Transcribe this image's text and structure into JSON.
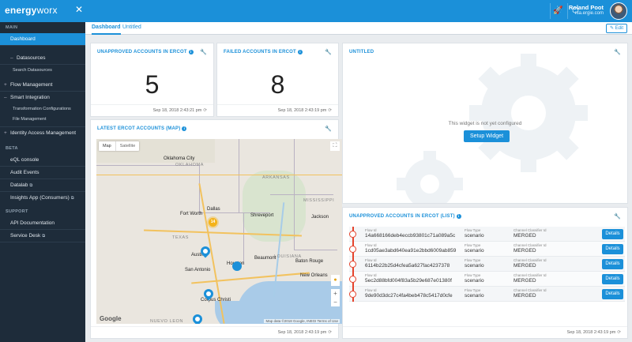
{
  "app": {
    "logo_bold": "energy",
    "logo_thin": "worx"
  },
  "user": {
    "name": "Roland Poot",
    "email": "rsa.ergie.com"
  },
  "sidebar": {
    "sections": {
      "main": "MAIN",
      "beta": "BETA",
      "support": "SUPPORT"
    },
    "items": {
      "dashboard": "Dashboard",
      "datasources": "Datasources",
      "search_datasources": "Search Datasources",
      "flow_management": "Flow Management",
      "smart_integration": "Smart Integration",
      "transformation_configurations": "Transformation Configurations",
      "file_management": "File Management",
      "identity_access": "Identity Access Management",
      "eql_console": "eQL console",
      "audit_events": "Audit Events",
      "datalab": "Datalab",
      "insights_app": "Insights App (Consumers)",
      "api_docs": "API Documentation",
      "service_desk": "Service Desk"
    }
  },
  "tabs": {
    "dashboard": "Dashboard",
    "untitled": "Untitled",
    "edit": "Edit"
  },
  "widgets": {
    "unapproved": {
      "title": "UNAPPROVED ACCOUNTS IN ERCOT",
      "value": "5",
      "timestamp": "Sep 18, 2018 2:43:21 pm"
    },
    "failed": {
      "title": "FAILED ACCOUNTS IN ERCOT",
      "value": "8",
      "timestamp": "Sep 18, 2018 2:43:19 pm"
    },
    "untitled": {
      "title": "UNTITLED",
      "message": "This widget is not yet configured",
      "button": "Setup Widget"
    },
    "map": {
      "title": "LATEST ERCOT ACCOUNTS (MAP)",
      "timestamp": "Sep 18, 2018 2:43:19 pm",
      "btn_map": "Map",
      "btn_satellite": "Satellite",
      "cluster_count": "14",
      "google": "Google",
      "attribution": "Map data ©2018 Google, INEGI   Terms of Use",
      "cities": {
        "oklahoma": "Oklahoma City",
        "oklahoma_state": "OKLAHOMA",
        "arkansas": "ARKANSAS",
        "mississippi": "MISSISSIPPI",
        "fort_worth": "Fort Worth",
        "dallas": "Dallas",
        "shreveport": "Shreveport",
        "jackson": "Jackson",
        "texas": "TEXAS",
        "louisiana": "LOUISIANA",
        "austin": "Austin",
        "san_antonio": "San Antonio",
        "houston": "Houston",
        "beaumont": "Beaumont",
        "baton_rouge": "Baton Rouge",
        "corpus": "Corpus Christi",
        "nuevo_leon": "NUEVO LEON",
        "new_orleans": "New Orleans"
      }
    },
    "list": {
      "title": "UNAPPROVED ACCOUNTS IN ERCOT (LIST)",
      "timestamp": "Sep 18, 2018 2:43:19 pm",
      "col_flow_id": "Flow Id",
      "col_flow_type": "Flow Type",
      "col_classifier": "Channel Classifier Id",
      "details": "Details",
      "rows": [
        {
          "flow_id": "14a668166deb4eccb93801c71a089a5c",
          "flow_type": "scenario",
          "classifier": "MERGED"
        },
        {
          "flow_id": "1cd05ae3abd640ea91e2bbd6009ab859",
          "flow_type": "scenario",
          "classifier": "MERGED"
        },
        {
          "flow_id": "6114b22b25d4cfea5a627fac4237378",
          "flow_type": "scenario",
          "classifier": "MERGED"
        },
        {
          "flow_id": "5ec2d88bfd004f83a5b29e687e01380f",
          "flow_type": "scenario",
          "classifier": "MERGED"
        },
        {
          "flow_id": "9de90d3dc27c4fa4beb478c5417d0cfe",
          "flow_type": "scenario",
          "classifier": "MERGED"
        }
      ]
    }
  }
}
